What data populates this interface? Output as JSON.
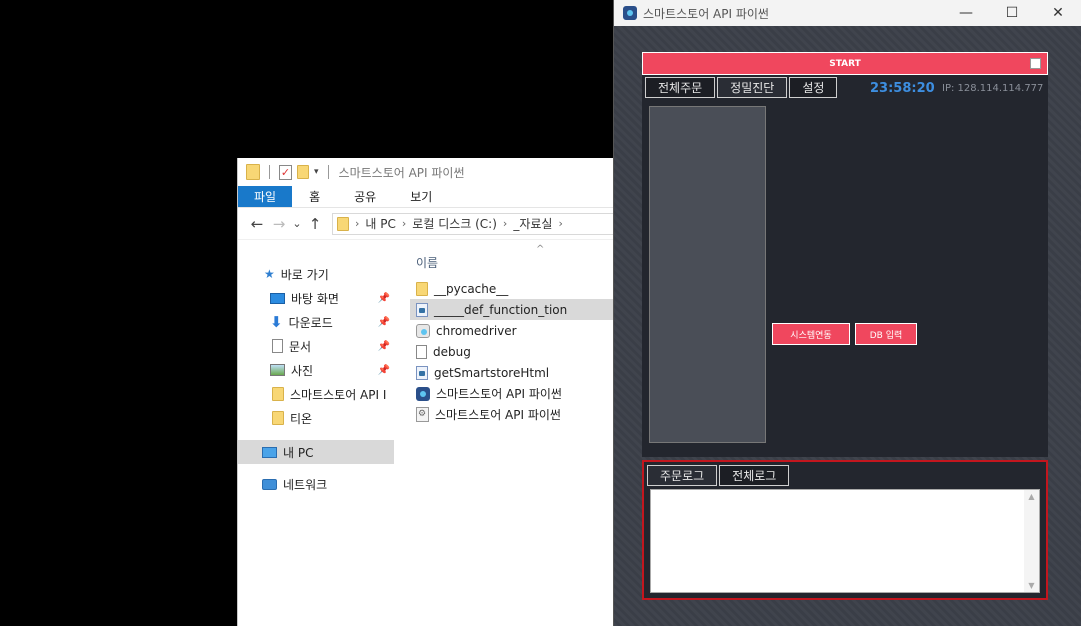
{
  "explorer": {
    "title": "스마트스토어 API 파이썬",
    "ribbon": [
      "파일",
      "홈",
      "공유",
      "보기"
    ],
    "breadcrumb": [
      "내 PC",
      "로컬 디스크 (C:)",
      "_자료실"
    ],
    "nav": {
      "quick_access": "바로 가기",
      "pinned": [
        "바탕 화면",
        "다운로드",
        "문서",
        "사진"
      ],
      "folders": [
        "스마트스토어 API I",
        "티온"
      ],
      "this_pc": "내 PC",
      "network": "네트워크"
    },
    "column_header": "이름",
    "files": [
      {
        "name": "__pycache__",
        "icon": "folder-icon"
      },
      {
        "name": "_____def_function_tion",
        "icon": "python-file-icon"
      },
      {
        "name": "chromedriver",
        "icon": "executable-icon"
      },
      {
        "name": "debug",
        "icon": "document-icon"
      },
      {
        "name": "getSmartstoreHtml",
        "icon": "python-file-icon"
      },
      {
        "name": "스마트스토어 API 파이썬",
        "icon": "app-icon"
      },
      {
        "name": "스마트스토어 API 파이썬",
        "icon": "config-file-icon"
      }
    ]
  },
  "app": {
    "title": "스마트스토어 API 파이썬",
    "start_label": "START",
    "tabs": [
      "전체주문",
      "정밀진단",
      "설정"
    ],
    "clock": "23:58:20",
    "ip": "IP: 128.114.114.777",
    "buttons": {
      "system_link": "시스템연동",
      "db_input": "DB 입력"
    },
    "log_tabs": [
      "주문로그",
      "전체로그"
    ],
    "colors": {
      "accent": "#f0475e",
      "clock": "#3d8ee0",
      "log_border": "#c3161e"
    }
  }
}
